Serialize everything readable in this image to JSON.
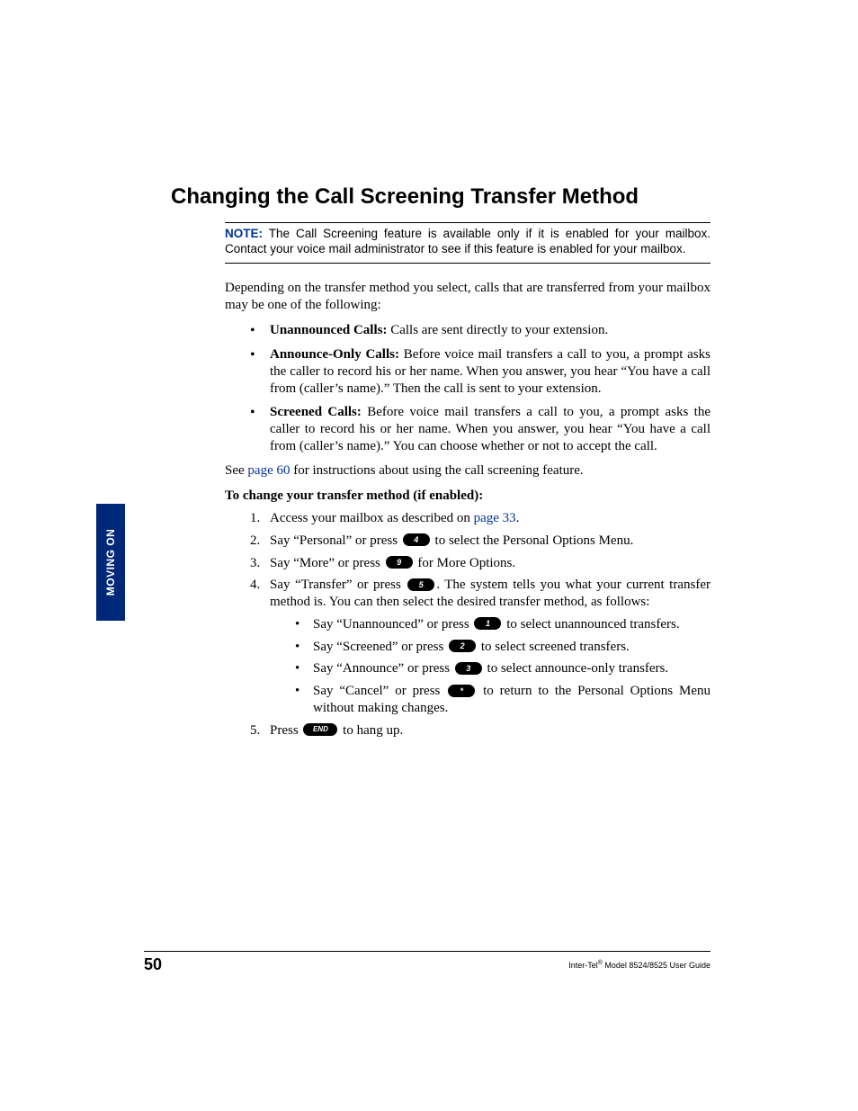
{
  "sideTab": "MOVING ON",
  "heading": "Changing the Call Screening Transfer Method",
  "note": {
    "label": "NOTE:",
    "text": "The Call Screening feature is available only if it is enabled for your mailbox. Contact your voice mail administrator to see if this feature is enabled for your mailbox."
  },
  "intro": "Depending on the transfer method you select, calls that are transferred from your mailbox may be one of the following:",
  "bullets": [
    {
      "term": "Unannounced Calls:",
      "text": " Calls are sent directly to your extension."
    },
    {
      "term": "Announce-Only Calls:",
      "text": " Before voice mail transfers a call to you, a prompt asks the caller to record his or her name. When you answer, you hear “You have a call from (caller’s name).” Then the call is sent to your extension."
    },
    {
      "term": "Screened Calls:",
      "text": " Before voice mail transfers a call to you, a prompt asks the caller to record his or her name. When you answer, you hear “You have a call from (caller’s name).” You can choose whether or not to accept the call."
    }
  ],
  "see": {
    "pre": "See ",
    "link": "page 60",
    "post": " for instructions about using the call screening feature."
  },
  "procHeading": "To change your transfer method (if enabled):",
  "steps": {
    "s1": {
      "pre": "Access your mailbox as described on ",
      "link": "page 33",
      "post": "."
    },
    "s2": {
      "pre": "Say “Personal” or press ",
      "key": "4",
      "post": " to select the Personal Options Menu."
    },
    "s3": {
      "pre": "Say “More” or press ",
      "key": "9",
      "post": " for More Options."
    },
    "s4": {
      "pre": "Say “Transfer” or press ",
      "key": "5",
      "post": ". The system tells you what your current transfer method is. You can then select the desired transfer method, as follows:"
    },
    "sub": {
      "a": {
        "pre": "Say “Unannounced” or press ",
        "key": "1",
        "post": " to select unannounced transfers."
      },
      "b": {
        "pre": "Say “Screened” or press ",
        "key": "2",
        "post": " to select screened transfers."
      },
      "c": {
        "pre": "Say “Announce” or press ",
        "key": "3",
        "post": " to select announce-only transfers."
      },
      "d": {
        "pre": "Say “Cancel” or press ",
        "key": "*",
        "post": " to return to the Personal Options Menu without making changes."
      }
    },
    "s5": {
      "pre": "Press ",
      "key": "END",
      "post": " to hang up."
    }
  },
  "footer": {
    "pageNumber": "50",
    "brand": "Inter-Tel",
    "suffix": " Model 8524/8525 User Guide"
  }
}
